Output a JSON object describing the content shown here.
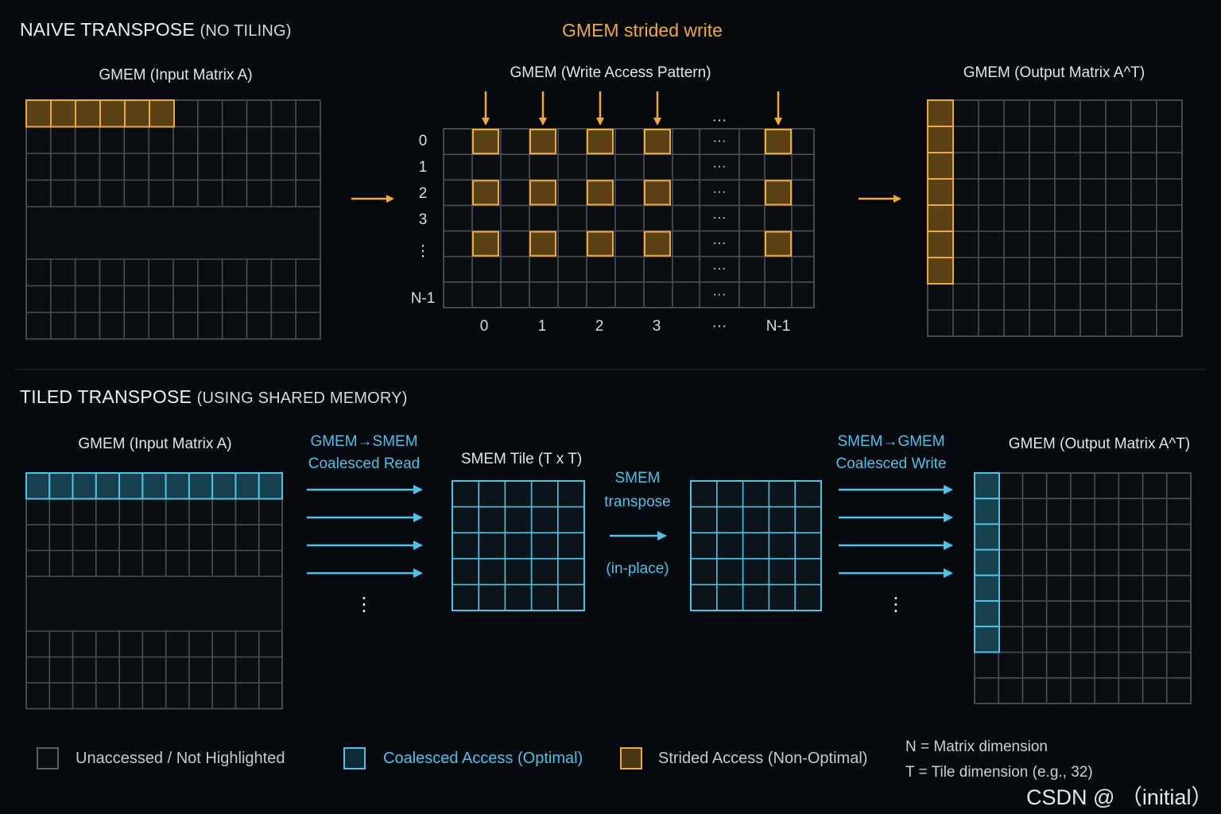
{
  "naive": {
    "title": "NAIVE TRANSPOSE",
    "title_sub": "(NO TILING)",
    "strided_label": "GMEM strided write",
    "input_label": "GMEM (Input Matrix A)",
    "pattern_label": "GMEM (Write Access Pattern)",
    "output_label": "GMEM (Output Matrix A^T)",
    "row_labels": [
      "0",
      "1",
      "2",
      "3",
      "⋮",
      "N-1"
    ],
    "col_labels": [
      "0",
      "1",
      "2",
      "3",
      "···",
      "N-1"
    ],
    "ellipsis_v": "⋮",
    "ellipsis_h": "···"
  },
  "tiled": {
    "title": "TILED TRANSPOSE",
    "title_sub": "(USING SHARED MEMORY)",
    "input_label": "GMEM (Input Matrix A)",
    "read_line1": "GMEM→SMEM",
    "read_line2": "Coalesced Read",
    "tile_label": "SMEM Tile (T x T)",
    "transpose_line1": "SMEM",
    "transpose_line2": "transpose",
    "transpose_line3": "(in-place)",
    "write_line1": "SMEM→GMEM",
    "write_line2": "Coalesced Write",
    "output_label": "GMEM (Output Matrix A^T)",
    "ellipsis_v": "⋮"
  },
  "legend": {
    "unaccessed": "Unaccessed / Not Highlighted",
    "coalesced": "Coalesced Access (Optimal)",
    "strided": "Strided Access (Non-Optimal)",
    "note_n": "N = Matrix dimension",
    "note_t": "T = Tile dimension (e.g., 32)"
  },
  "watermark": "CSDN @ （initial）",
  "colors": {
    "background": "#06090d",
    "grid": "#4a4f55",
    "orange": "#f2a93b",
    "orange_fill": "#5a4216",
    "cyan": "#4cc3e8",
    "cyan_fill": "#16404e"
  }
}
